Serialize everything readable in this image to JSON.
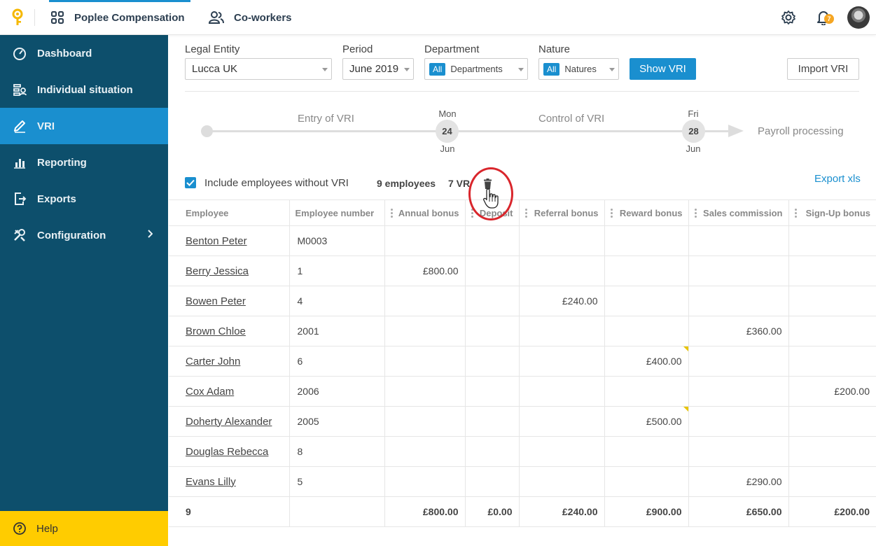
{
  "topbar": {
    "app_name": "Poplee Compensation",
    "coworkers": "Co-workers",
    "notification_count": "7"
  },
  "sidebar": {
    "items": [
      {
        "label": "Dashboard",
        "icon": "gauge-icon"
      },
      {
        "label": "Individual situation",
        "icon": "person-list-icon"
      },
      {
        "label": "VRI",
        "icon": "pencil-icon",
        "active": true
      },
      {
        "label": "Reporting",
        "icon": "bar-chart-icon"
      },
      {
        "label": "Exports",
        "icon": "export-icon"
      },
      {
        "label": "Configuration",
        "icon": "tools-icon"
      }
    ],
    "help": "Help"
  },
  "filters": {
    "legal_entity_label": "Legal Entity",
    "legal_entity_value": "Lucca UK",
    "period_label": "Period",
    "period_value": "June 2019",
    "department_label": "Department",
    "department_chip": "All",
    "department_value": "Departments",
    "nature_label": "Nature",
    "nature_chip": "All",
    "nature_value": "Natures",
    "show_button": "Show VRI",
    "import_button": "Import VRI"
  },
  "timeline": {
    "step1": "Entry of VRI",
    "step2": "Control of VRI",
    "step3": "Payroll processing",
    "date1_day": "Mon",
    "date1_num": "24",
    "date1_month": "Jun",
    "date2_day": "Fri",
    "date2_num": "28",
    "date2_month": "Jun"
  },
  "summary": {
    "include_label": "Include employees without VRI",
    "include_checked": true,
    "employees_count": "9 employees",
    "vri_count": "7 VR",
    "export": "Export xls"
  },
  "table": {
    "headers": [
      "Employee",
      "Employee number",
      "Annual bonus",
      "Deposit",
      "Referral bonus",
      "Reward bonus",
      "Sales commission",
      "Sign-Up bonus"
    ],
    "rows": [
      [
        "Benton Peter",
        "M0003",
        "",
        "",
        "",
        "",
        "",
        ""
      ],
      [
        "Berry Jessica",
        "1",
        "£800.00",
        "",
        "",
        "",
        "",
        ""
      ],
      [
        "Bowen Peter",
        "4",
        "",
        "",
        "£240.00",
        "",
        "",
        ""
      ],
      [
        "Brown Chloe",
        "2001",
        "",
        "",
        "",
        "",
        "£360.00",
        ""
      ],
      [
        "Carter John",
        "6",
        "",
        "",
        "",
        "£400.00",
        "",
        ""
      ],
      [
        "Cox Adam",
        "2006",
        "",
        "",
        "",
        "",
        "",
        "£200.00"
      ],
      [
        "Doherty Alexander",
        "2005",
        "",
        "",
        "",
        "£500.00",
        "",
        ""
      ],
      [
        "Douglas Rebecca",
        "8",
        "",
        "",
        "",
        "",
        "",
        ""
      ],
      [
        "Evans Lilly",
        "5",
        "",
        "",
        "",
        "",
        "£290.00",
        ""
      ]
    ],
    "totals": [
      "9",
      "",
      "£800.00",
      "£0.00",
      "£240.00",
      "£900.00",
      "£650.00",
      "£200.00"
    ]
  }
}
